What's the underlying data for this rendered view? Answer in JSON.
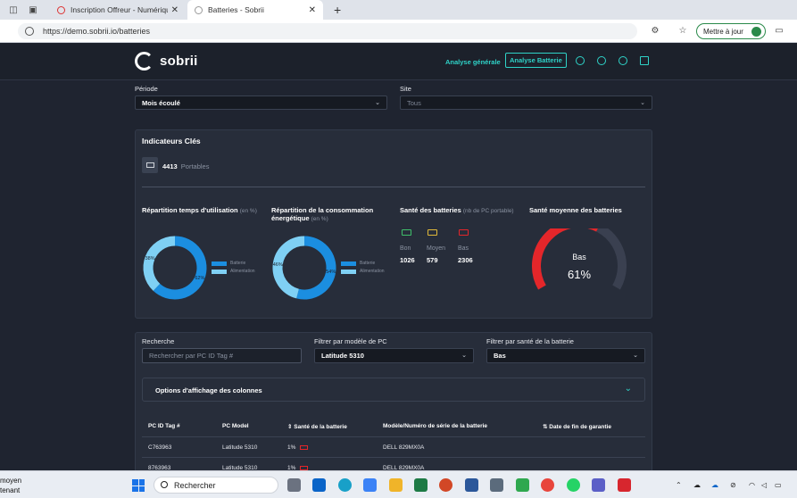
{
  "browser": {
    "tabs": [
      {
        "title": "Inscription Offreur - Numérique",
        "active": false
      },
      {
        "title": "Batteries - Sobrii",
        "active": true
      }
    ],
    "url": "https://demo.sobrii.io/batteries",
    "update_label": "Mettre à jour"
  },
  "header": {
    "brand": "sobrii",
    "nav": [
      "Analyse générale",
      "Analyse Batterie"
    ],
    "icons": [
      "settings-icon",
      "help-icon",
      "user-icon",
      "logout-icon"
    ]
  },
  "filters": {
    "periode_label": "Période",
    "periode_value": "Mois écoulé",
    "site_label": "Site",
    "site_value": "Tous"
  },
  "indicators": {
    "title": "Indicateurs Clés",
    "count": "4413",
    "count_label": "Portables",
    "usage": {
      "title": "Répartition temps d'utilisation",
      "unit": "(en %)",
      "legend": [
        "Batterie",
        "Alimentation"
      ]
    },
    "energy": {
      "title": "Répartition de la consommation énergétique",
      "unit": "(en %)",
      "legend": [
        "Batterie",
        "Alimentation"
      ]
    },
    "health": {
      "title": "Santé des batteries",
      "unit": "(nb de PC portable)",
      "items": [
        {
          "label": "Bon",
          "value": "1026",
          "color": "#3fbf6a"
        },
        {
          "label": "Moyen",
          "value": "579",
          "color": "#e0b93a"
        },
        {
          "label": "Bas",
          "value": "2306",
          "color": "#e4262a"
        }
      ]
    },
    "avg": {
      "title": "Santé moyenne des batteries",
      "label": "Bas",
      "value": "61%",
      "fraction": 0.61
    }
  },
  "chart_data": [
    {
      "type": "pie",
      "title": "Répartition temps d'utilisation",
      "labels": [
        "Batterie",
        "Alimentation"
      ],
      "values": [
        62,
        38
      ]
    },
    {
      "type": "pie",
      "title": "Répartition de la consommation énergétique",
      "labels": [
        "Batterie",
        "Alimentation"
      ],
      "values": [
        54,
        46
      ]
    }
  ],
  "search": {
    "recherche_label": "Recherche",
    "recherche_placeholder": "Rechercher par PC ID Tag #",
    "model_label": "Filtrer par modèle de PC",
    "model_value": "Latitude 5310",
    "health_label": "Filtrer par santé de la batterie",
    "health_value": "Bas",
    "column_options": "Options d'affichage des colonnes"
  },
  "table": {
    "headers": [
      "PC ID Tag #",
      "PC Model",
      "⇕ Santé de la batterie",
      "Modèle/Numéro de série de la batterie",
      "⇅ Date de fin de garantie"
    ],
    "rows": [
      {
        "tag": "C763963",
        "model": "Latitude 5310",
        "health": "1%",
        "serial": "DELL 829MX0A"
      },
      {
        "tag": "8763963",
        "model": "Latitude 5310",
        "health": "1%",
        "serial": "DELL 829MX0A"
      }
    ]
  },
  "taskbar": {
    "left_text_1": "moyen",
    "left_text_2": "tenant",
    "search_placeholder": "Rechercher"
  }
}
